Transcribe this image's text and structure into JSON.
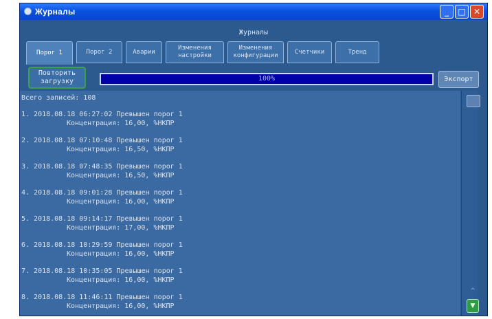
{
  "window": {
    "title": "Журналы",
    "minimize_icon": "minimize-icon",
    "maximize_icon": "maximize-icon",
    "close_icon": "close-icon"
  },
  "header": {
    "title": "Журналы"
  },
  "tabs": [
    {
      "label": "Порог 1",
      "active": true
    },
    {
      "label": "Порог 2",
      "active": false
    },
    {
      "label": "Аварии",
      "active": false
    },
    {
      "label": "Изменения настройки",
      "active": false
    },
    {
      "label": "Изменения конфигурации",
      "active": false
    },
    {
      "label": "Счетчики",
      "active": false
    },
    {
      "label": "Тренд",
      "active": false
    }
  ],
  "toolbar": {
    "repeat_label": "Повторить загрузку",
    "progress_text": "100%",
    "progress_value": 1.0,
    "export_label": "Экспорт"
  },
  "log": {
    "count_text": "Всего записей: 108",
    "entries": [
      {
        "line1": "1. 2018.08.18 06:27:02 Превышен порог 1",
        "line2": "Концентрация: 16,00, %НКПР"
      },
      {
        "line1": "2. 2018.08.18 07:10:48 Превышен порог 1",
        "line2": "Концентрация: 16,50, %НКПР"
      },
      {
        "line1": "3. 2018.08.18 07:48:35 Превышен порог 1",
        "line2": "Концентрация: 16,50, %НКПР"
      },
      {
        "line1": "4. 2018.08.18 09:01:28 Превышен порог 1",
        "line2": "Концентрация: 16,00, %НКПР"
      },
      {
        "line1": "5. 2018.08.18 09:14:17 Превышен порог 1",
        "line2": "Концентрация: 17,00, %НКПР"
      },
      {
        "line1": "6. 2018.08.18 10:29:59 Превышен порог 1",
        "line2": "Концентрация: 16,00, %НКПР"
      },
      {
        "line1": "7. 2018.08.18 10:35:05 Превышен порог 1",
        "line2": "Концентрация: 16,00, %НКПР"
      },
      {
        "line1": "8. 2018.08.18 11:46:11 Превышен порог 1",
        "line2": "Концентрация: 16,00, %НКПР"
      }
    ]
  },
  "scrollbar": {
    "up_icon": "scroll-up-icon",
    "down_icon": "scroll-down-icon"
  }
}
